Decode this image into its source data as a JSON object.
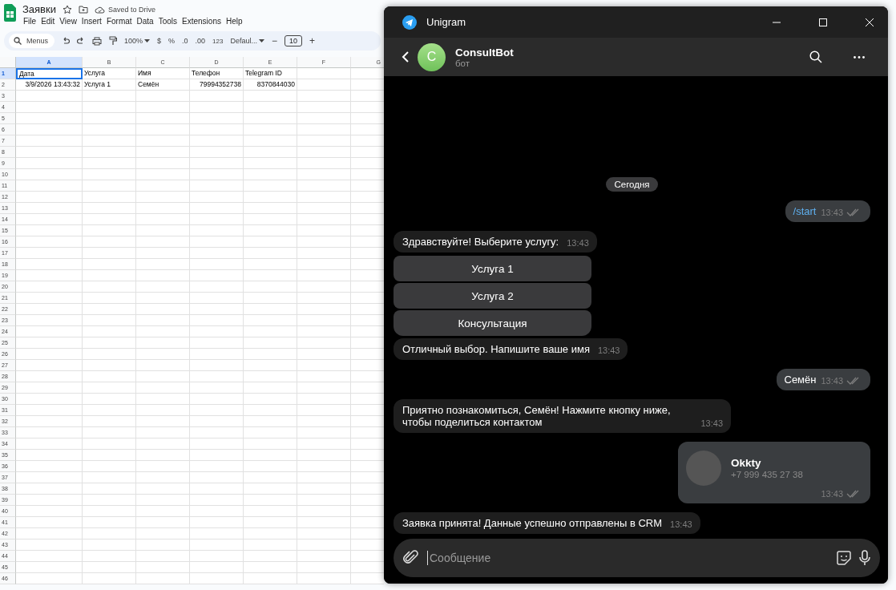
{
  "sheet": {
    "title": "Заявки",
    "save_status": "Saved to Drive",
    "menu": [
      "File",
      "Edit",
      "View",
      "Insert",
      "Format",
      "Data",
      "Tools",
      "Extensions",
      "Help"
    ],
    "toolbar": {
      "search_placeholder": "Menus",
      "zoom": "100%",
      "currency": "$",
      "percent": "%",
      "decrease_decimals": ".0",
      "increase_decimals": ".00",
      "number_format": "123",
      "font": "Defaul...",
      "minus": "−",
      "font_size": "10",
      "plus": "+"
    },
    "columns": [
      {
        "label": "A",
        "selected": true
      },
      {
        "label": "B",
        "selected": false
      },
      {
        "label": "C",
        "selected": false
      },
      {
        "label": "D",
        "selected": false
      },
      {
        "label": "E",
        "selected": false
      },
      {
        "label": "F",
        "selected": false
      },
      {
        "label": "G",
        "selected": false
      }
    ],
    "rows": [
      {
        "number": "1",
        "cells": [
          {
            "text": "Дата",
            "right_aligned": false,
            "selected": true
          },
          {
            "text": "Услуга",
            "right_aligned": false,
            "selected": false
          },
          {
            "text": "Имя",
            "right_aligned": false,
            "selected": false
          },
          {
            "text": "Телефон",
            "right_aligned": false,
            "selected": false
          },
          {
            "text": "Telegram ID",
            "right_aligned": false,
            "selected": false
          }
        ]
      },
      {
        "number": "2",
        "cells": [
          {
            "text": "3/9/2026 13:43:32",
            "right_aligned": true,
            "selected": false
          },
          {
            "text": "Услуга 1",
            "right_aligned": false,
            "selected": false
          },
          {
            "text": "Семён",
            "right_aligned": false,
            "selected": false
          },
          {
            "text": "79994352738",
            "right_aligned": true,
            "selected": false
          },
          {
            "text": "8370844030",
            "right_aligned": true,
            "selected": false
          }
        ]
      },
      {
        "number": "3"
      },
      {
        "number": "4"
      },
      {
        "number": "5"
      },
      {
        "number": "6"
      },
      {
        "number": "7"
      },
      {
        "number": "8"
      },
      {
        "number": "9"
      },
      {
        "number": "10"
      },
      {
        "number": "11"
      },
      {
        "number": "12"
      },
      {
        "number": "13"
      },
      {
        "number": "14"
      },
      {
        "number": "15"
      },
      {
        "number": "16"
      },
      {
        "number": "17"
      },
      {
        "number": "18"
      },
      {
        "number": "19"
      },
      {
        "number": "20"
      },
      {
        "number": "21"
      },
      {
        "number": "22"
      },
      {
        "number": "23"
      },
      {
        "number": "24"
      },
      {
        "number": "25"
      },
      {
        "number": "26"
      },
      {
        "number": "27"
      },
      {
        "number": "28"
      },
      {
        "number": "29"
      },
      {
        "number": "30"
      },
      {
        "number": "31"
      },
      {
        "number": "32"
      },
      {
        "number": "33"
      },
      {
        "number": "34"
      },
      {
        "number": "35"
      },
      {
        "number": "36"
      },
      {
        "number": "37"
      },
      {
        "number": "38"
      },
      {
        "number": "39"
      },
      {
        "number": "40"
      },
      {
        "number": "41"
      },
      {
        "number": "42"
      },
      {
        "number": "43"
      },
      {
        "number": "44"
      },
      {
        "number": "45"
      },
      {
        "number": "46"
      }
    ]
  },
  "telegram": {
    "window_title": "Unigram",
    "chat": {
      "name": "ConsultBot",
      "status": "бот",
      "avatar_letter": "C"
    },
    "messages": [
      {
        "kind": "date",
        "text": "Сегодня"
      },
      {
        "kind": "outgoing",
        "text": "/start",
        "command": true,
        "time": "13:43",
        "read": true
      },
      {
        "kind": "incoming",
        "text": "Здравствуйте! Выберите услугу:",
        "time": "13:43"
      },
      {
        "kind": "keyboard",
        "buttons": [
          "Услуга 1",
          "Услуга 2",
          "Консультация"
        ]
      },
      {
        "kind": "incoming",
        "text": "Отличный выбор. Напишите ваше имя",
        "time": "13:43"
      },
      {
        "kind": "outgoing",
        "text": "Семён",
        "command": false,
        "time": "13:43",
        "read": true
      },
      {
        "kind": "incoming",
        "text": "Приятно познакомиться, Семён! Нажмите кнопку ниже, чтобы поделиться контактом",
        "time": "13:43"
      },
      {
        "kind": "contact",
        "name": "Okkty",
        "phone": "+7 999 435 27 38",
        "time": "13:43",
        "read": true
      },
      {
        "kind": "incoming",
        "text": "Заявка принята! Данные успешно отправлены в CRM",
        "time": "13:43"
      }
    ],
    "composer": {
      "placeholder": "Сообщение"
    }
  }
}
